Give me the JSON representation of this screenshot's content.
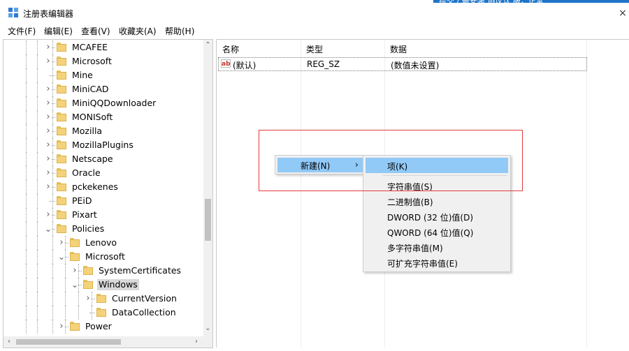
{
  "window": {
    "title": "注册表编辑器",
    "top_overlay_text": "提交 / 最安装  协议认  服，正常",
    "close_glyph": "×"
  },
  "menubar": {
    "items": [
      "文件(F)",
      "编辑(E)",
      "查看(V)",
      "收藏夹(A)",
      "帮助(H)"
    ]
  },
  "tree": {
    "items": [
      {
        "label": "MCAFEE",
        "level": 0,
        "expander": "right"
      },
      {
        "label": "Microsoft",
        "level": 0,
        "expander": "right"
      },
      {
        "label": "Mine",
        "level": 0,
        "expander": "none"
      },
      {
        "label": "MiniCAD",
        "level": 0,
        "expander": "right"
      },
      {
        "label": "MiniQQDownloader",
        "level": 0,
        "expander": "right"
      },
      {
        "label": "MONISoft",
        "level": 0,
        "expander": "right"
      },
      {
        "label": "Mozilla",
        "level": 0,
        "expander": "right"
      },
      {
        "label": "MozillaPlugins",
        "level": 0,
        "expander": "right"
      },
      {
        "label": "Netscape",
        "level": 0,
        "expander": "right"
      },
      {
        "label": "Oracle",
        "level": 0,
        "expander": "right"
      },
      {
        "label": "pckekenes",
        "level": 0,
        "expander": "right"
      },
      {
        "label": "PEiD",
        "level": 0,
        "expander": "none"
      },
      {
        "label": "Pixart",
        "level": 0,
        "expander": "right"
      },
      {
        "label": "Policies",
        "level": 0,
        "expander": "down"
      },
      {
        "label": "Lenovo",
        "level": 1,
        "expander": "right"
      },
      {
        "label": "Microsoft",
        "level": 1,
        "expander": "down"
      },
      {
        "label": "SystemCertificates",
        "level": 2,
        "expander": "right"
      },
      {
        "label": "Windows",
        "level": 2,
        "expander": "down",
        "selected": true
      },
      {
        "label": "CurrentVersion",
        "level": 3,
        "expander": "right"
      },
      {
        "label": "DataCollection",
        "level": 3,
        "expander": "none"
      },
      {
        "label": "Power",
        "level": 1,
        "expander": "right"
      }
    ]
  },
  "list": {
    "columns": [
      "名称",
      "类型",
      "数据"
    ],
    "rows": [
      {
        "icon": "ab",
        "name": "(默认)",
        "type": "REG_SZ",
        "data": "(数值未设置)"
      }
    ]
  },
  "context_menu": {
    "new_label": "新建(N)",
    "arrow": "›",
    "submenu": [
      "项(K)",
      "字符串值(S)",
      "二进制值(B)",
      "DWORD (32 位)值(D)",
      "QWORD (64 位)值(Q)",
      "多字符串值(M)",
      "可扩充字符串值(E)"
    ]
  },
  "colors": {
    "highlight": "#91c9f7",
    "annotation": "#e23a3a",
    "selected_tree": "#d9d9d9"
  },
  "icons": {
    "app": "registry-editor-icon",
    "folder": "folder-icon",
    "string_value": "ab-string-icon"
  }
}
